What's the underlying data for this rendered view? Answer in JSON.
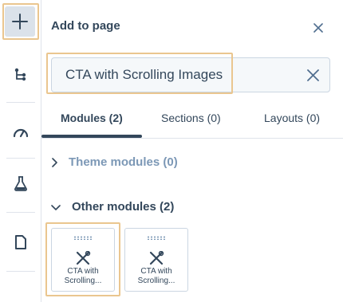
{
  "rail": {
    "items": [
      {
        "icon": "plus-icon"
      },
      {
        "icon": "hierarchy-icon"
      },
      {
        "icon": "gauge-icon"
      },
      {
        "icon": "flask-icon"
      },
      {
        "icon": "page-icon"
      }
    ]
  },
  "panel": {
    "title": "Add to page",
    "close_icon": "close-icon"
  },
  "search": {
    "value": "CTA with Scrolling Images",
    "clear_icon": "clear-icon"
  },
  "tabs": [
    {
      "label": "Modules (2)",
      "active": true
    },
    {
      "label": "Sections (0)",
      "active": false
    },
    {
      "label": "Layouts (0)",
      "active": false
    }
  ],
  "groups": [
    {
      "label": "Theme modules (0)",
      "expanded": false
    },
    {
      "label": "Other modules (2)",
      "expanded": true
    }
  ],
  "modules": [
    {
      "line1": "CTA with",
      "line2": "Scrolling..."
    },
    {
      "line1": "CTA with",
      "line2": "Scrolling..."
    }
  ],
  "colors": {
    "text": "#33475b",
    "muted": "#7c98b6",
    "highlight": "#eac68f",
    "active_rail": "#dbe2ea"
  }
}
